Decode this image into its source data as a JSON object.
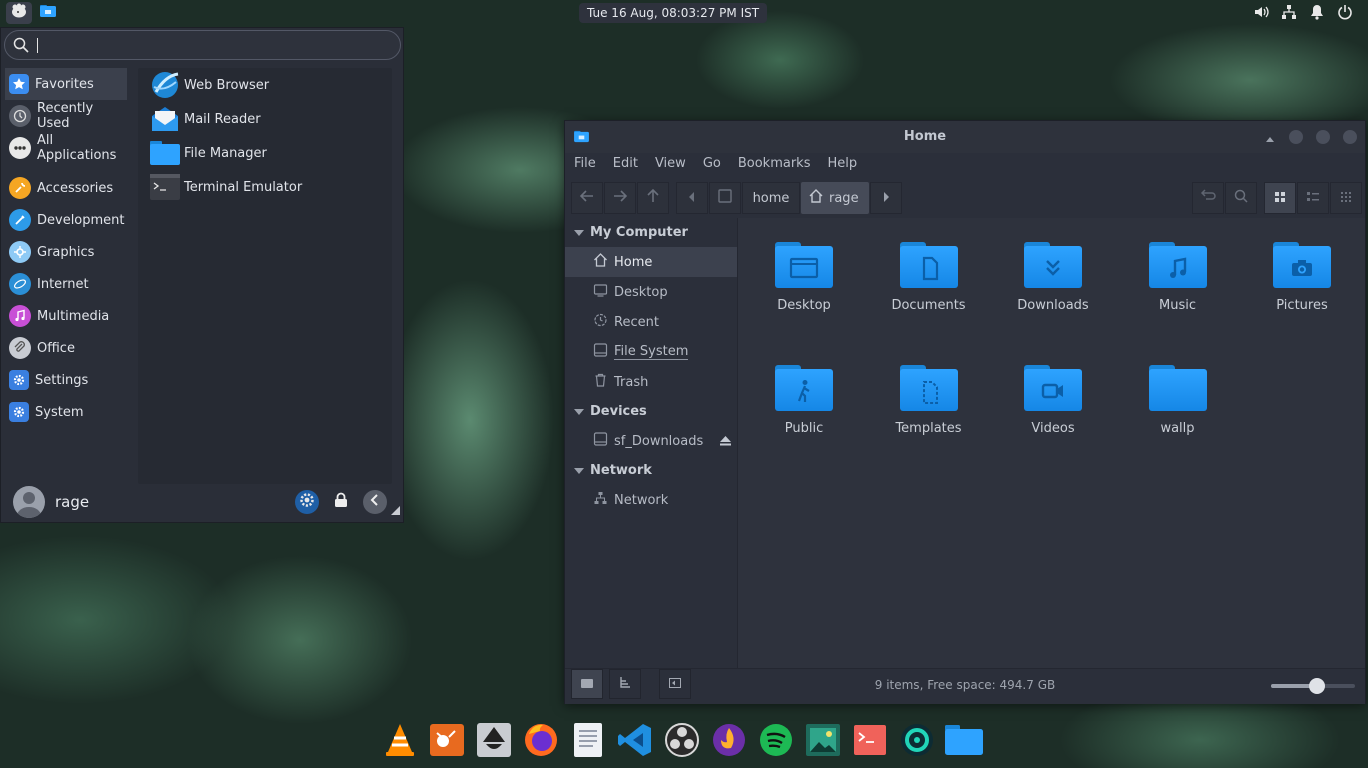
{
  "panel": {
    "clock": "Tue 16 Aug, 08:03:27 PM IST",
    "left_icons": [
      "whisker-menu-icon",
      "files-icon"
    ],
    "tray_icons": [
      "volume-icon",
      "network-icon",
      "notification-bell-icon",
      "power-icon"
    ]
  },
  "whisker": {
    "search_value": "",
    "categories": [
      {
        "label": "Favorites",
        "icon": "star-icon",
        "color": "#3b8df0"
      },
      {
        "label": "Recently Used",
        "icon": "clock-icon",
        "color": "#5a5f6a"
      },
      {
        "label": "All Applications",
        "icon": "apps-icon",
        "color": "#e8e8e8"
      },
      {
        "label": "Accessories",
        "icon": "wrench-icon",
        "color": "#f5a623"
      },
      {
        "label": "Development",
        "icon": "development-icon",
        "color": "#2d9be8"
      },
      {
        "label": "Graphics",
        "icon": "graphics-icon",
        "color": "#8ecaf5"
      },
      {
        "label": "Internet",
        "icon": "globe-icon",
        "color": "#2b8fd6"
      },
      {
        "label": "Multimedia",
        "icon": "music-icon",
        "color": "#c84fd6"
      },
      {
        "label": "Office",
        "icon": "paperclip-icon",
        "color": "#c9ccd3"
      },
      {
        "label": "Settings",
        "icon": "gear-icon",
        "color": "#3a7fe0"
      },
      {
        "label": "System",
        "icon": "system-icon",
        "color": "#3a7fe0"
      }
    ],
    "apps": [
      {
        "label": "Web Browser",
        "icon": "web-browser-icon"
      },
      {
        "label": "Mail Reader",
        "icon": "mail-icon"
      },
      {
        "label": "File Manager",
        "icon": "folder-icon"
      },
      {
        "label": "Terminal Emulator",
        "icon": "terminal-icon"
      }
    ],
    "user": "rage"
  },
  "filemanager": {
    "title": "Home",
    "menu": [
      "File",
      "Edit",
      "View",
      "Go",
      "Bookmarks",
      "Help"
    ],
    "breadcrumb": [
      "home",
      "rage"
    ],
    "sidebar": {
      "sections": [
        {
          "label": "My Computer",
          "items": [
            {
              "label": "Home",
              "icon": "home-icon"
            },
            {
              "label": "Desktop",
              "icon": "desktop-icon"
            },
            {
              "label": "Recent",
              "icon": "recent-icon"
            },
            {
              "label": "File System",
              "icon": "drive-icon"
            },
            {
              "label": "Trash",
              "icon": "trash-icon"
            }
          ]
        },
        {
          "label": "Devices",
          "items": [
            {
              "label": "sf_Downloads",
              "icon": "drive-icon"
            }
          ]
        },
        {
          "label": "Network",
          "items": [
            {
              "label": "Network",
              "icon": "network-icon"
            }
          ]
        }
      ]
    },
    "folders": [
      {
        "label": "Desktop",
        "icon": "desktop-icon"
      },
      {
        "label": "Documents",
        "icon": "document-icon"
      },
      {
        "label": "Downloads",
        "icon": "download-icon"
      },
      {
        "label": "Music",
        "icon": "music-icon"
      },
      {
        "label": "Pictures",
        "icon": "camera-icon"
      },
      {
        "label": "Public",
        "icon": "person-icon"
      },
      {
        "label": "Templates",
        "icon": "template-icon"
      },
      {
        "label": "Videos",
        "icon": "video-icon"
      },
      {
        "label": "wallp",
        "icon": "folder-icon"
      }
    ],
    "status": "9 items, Free space: 494.7 GB",
    "zoom_level": 0.55
  },
  "dock": [
    "vlc-icon",
    "gimp-icon",
    "inkscape-icon",
    "firefox-icon",
    "text-editor-icon",
    "vscode-icon",
    "obs-icon",
    "flame-icon",
    "spotify-icon",
    "photo-viewer-icon",
    "terminal-icon",
    "gnome-disk-icon",
    "files-icon"
  ]
}
